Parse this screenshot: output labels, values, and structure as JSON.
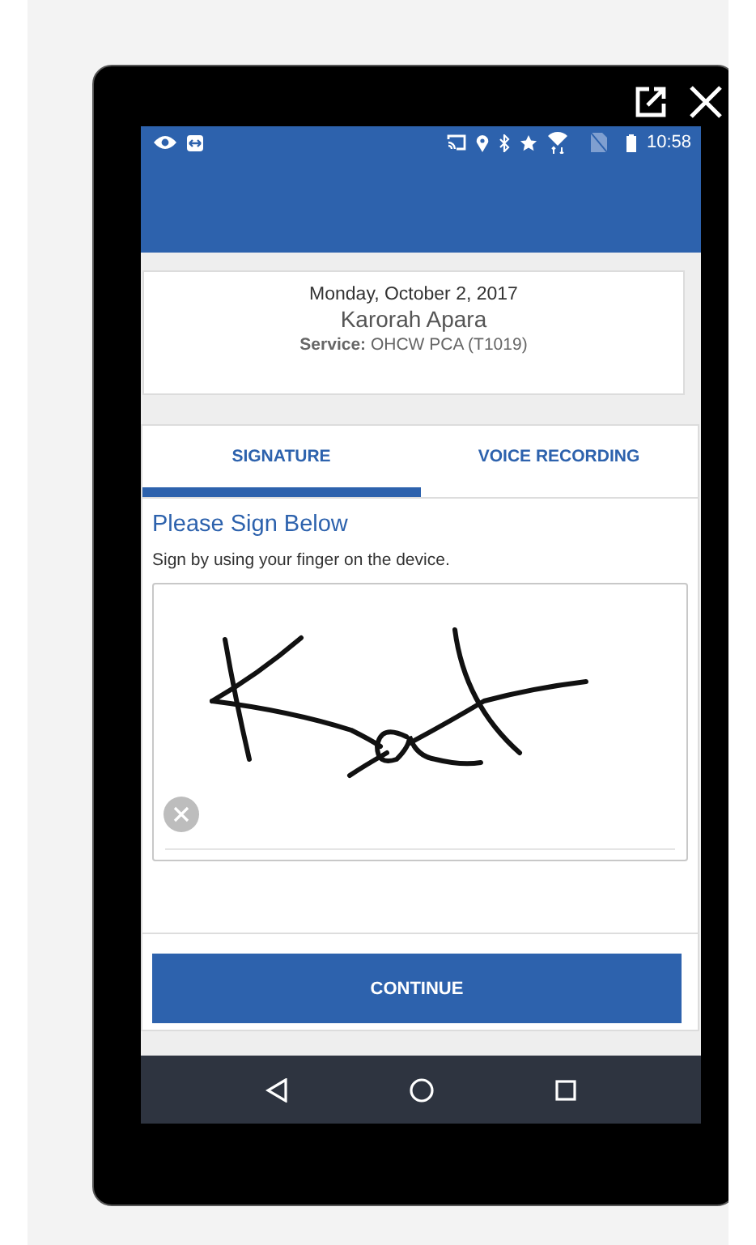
{
  "status_bar": {
    "time": "10:58"
  },
  "visit": {
    "date": "Monday, October 2, 2017",
    "client": "Karorah Apara",
    "service_label": "Service:",
    "service": "OHCW PCA (T1019)"
  },
  "tabs": [
    {
      "label": "SIGNATURE",
      "selected": true
    },
    {
      "label": "VOICE RECORDING",
      "selected": false
    }
  ],
  "signature": {
    "title": "Please Sign Below",
    "instruction": "Sign by using your finger on the device.",
    "signed": true
  },
  "continue_button": "CONTINUE"
}
